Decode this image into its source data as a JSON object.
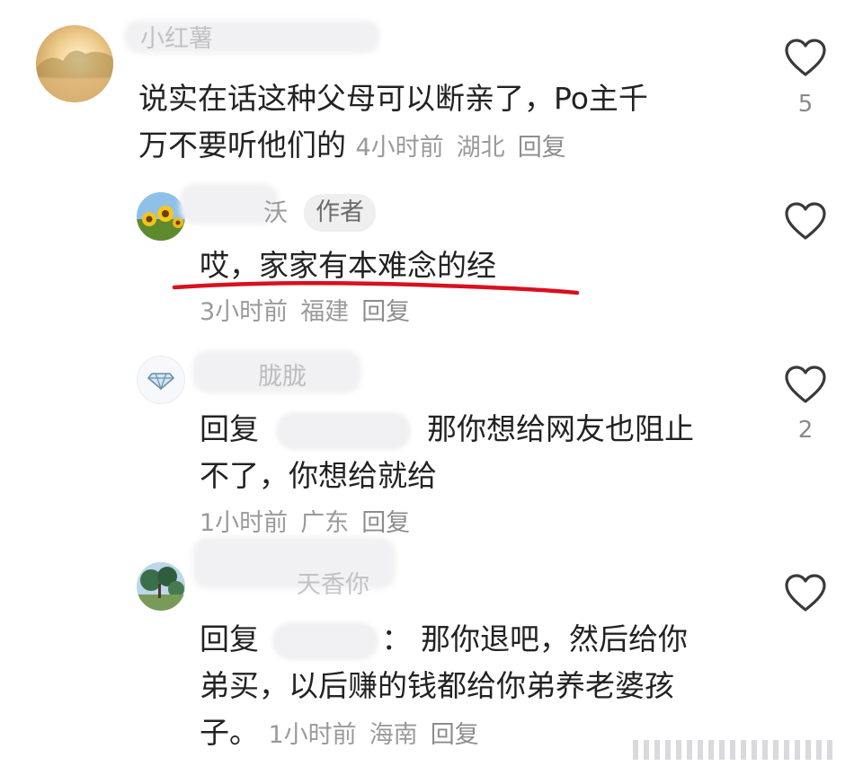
{
  "comments": [
    {
      "name_fragment": "小红薯",
      "text": "说实在话这种父母可以断亲了，Po主千万不要听他们的",
      "line1": "说实在话这种父母可以断亲了，Po主千",
      "line2": "万不要听他们的",
      "time": "4小时前",
      "region": "湖北",
      "reply_label": "回复",
      "likes": "5",
      "avatar_icon": "sunset-landscape-avatar"
    },
    {
      "name_fragment": "沃",
      "badge": "作者",
      "text": "哎，家家有本难念的经",
      "time": "3小时前",
      "region": "福建",
      "reply_label": "回复",
      "likes": "",
      "avatar_icon": "sunflower-avatar"
    },
    {
      "name_fragment": "胧胧",
      "reply_prefix": "回复",
      "reply_text_line1": "那你想给网友也阻止",
      "reply_text_line2": "不了，你想给就给",
      "time": "1小时前",
      "region": "广东",
      "reply_label": "回复",
      "likes": "2",
      "avatar_icon": "diamond-avatar"
    },
    {
      "name_fragment": "天香你",
      "reply_prefix": "回复",
      "reply_separator": "：",
      "reply_text_line1": "那你退吧，然后给你",
      "reply_text_line2": "弟买，以后赚的钱都给你弟养老婆孩",
      "reply_text_line3": "子。",
      "time": "1小时前",
      "region": "海南",
      "reply_label": "回复",
      "likes": "",
      "avatar_icon": "tree-landscape-avatar"
    }
  ],
  "colors": {
    "underline": "#d8101f",
    "meta_text": "#9a9a9a",
    "body_text": "#222222",
    "heart_stroke": "#3a3a3a"
  }
}
